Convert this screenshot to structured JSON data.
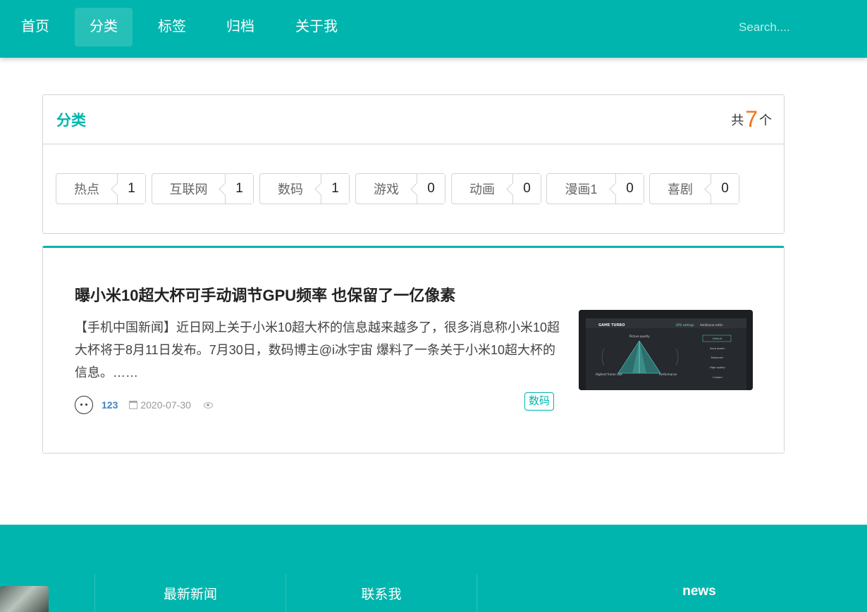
{
  "nav": {
    "items": [
      {
        "label": "首页",
        "active": false
      },
      {
        "label": "分类",
        "active": true
      },
      {
        "label": "标签",
        "active": false
      },
      {
        "label": "归档",
        "active": false
      },
      {
        "label": "关于我",
        "active": false
      }
    ],
    "search_placeholder": "Search...."
  },
  "category_panel": {
    "title": "分类",
    "count_prefix": "共",
    "count": "7",
    "count_suffix": "个",
    "tags": [
      {
        "name": "热点",
        "count": "1"
      },
      {
        "name": "互联网",
        "count": "1"
      },
      {
        "name": "数码",
        "count": "1"
      },
      {
        "name": "游戏",
        "count": "0"
      },
      {
        "name": "动画",
        "count": "0"
      },
      {
        "name": "漫画1",
        "count": "0"
      },
      {
        "name": "喜剧",
        "count": "0"
      }
    ]
  },
  "article": {
    "title": "曝小米10超大杯可手动调节GPU频率 也保留了一亿像素",
    "description": "【手机中国新闻】近日网上关于小米10超大杯的信息越来越多了，很多消息称小米10超大杯将于8月11日发布。7月30日，数码博主@i冰宇宙 爆料了一条关于小米10超大杯的信息。……",
    "author": "123",
    "date": "2020-07-30",
    "category": "数码",
    "thumbnail": {
      "brand": "GAME TURBO",
      "tab_gpu": "GPU settings",
      "tab_additional": "Additional settin",
      "axis_top": "Picture quality",
      "axis_left": "Highest frame rate",
      "axis_right": "Performance",
      "options": [
        "Default",
        "Save power",
        "Balanced",
        "High quality",
        "Custom"
      ]
    }
  },
  "footer": {
    "col1_title": "最新新闻",
    "col2_title": "联系我",
    "col3_title": "news"
  },
  "colors": {
    "primary": "#00b5ad",
    "accent": "#f2711c",
    "link": "#4183c4"
  }
}
